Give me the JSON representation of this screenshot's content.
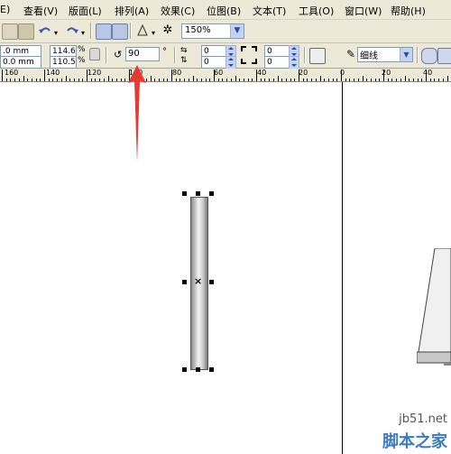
{
  "menu": [
    {
      "label": "查看(V)"
    },
    {
      "label": "版面(L)"
    },
    {
      "label": "排列(A)"
    },
    {
      "label": "效果(C)"
    },
    {
      "label": "位图(B)"
    },
    {
      "label": "文本(T)"
    },
    {
      "label": "工具(O)"
    },
    {
      "label": "窗口(W)"
    },
    {
      "label": "帮助(H)"
    }
  ],
  "toolbar": {
    "zoom_value": "150%"
  },
  "property_bar": {
    "x_value": ".0 mm",
    "y_value": "0.0 mm",
    "scale_x": "114.6",
    "scale_y": "110.5",
    "percent_symbol": "%",
    "rotation_value": "90",
    "degree_symbol": "°",
    "corner_top": "0",
    "corner_bottom": "0",
    "corner_top_right": "0",
    "corner_bottom_right": "0",
    "outline_label": "细线"
  },
  "ruler": {
    "labels": [
      "160",
      "140",
      "120",
      "100",
      "80",
      "60",
      "40",
      "20",
      "0",
      "20",
      "40"
    ]
  },
  "watermark": {
    "site": "jb51.net",
    "brand": "脚本之家"
  },
  "colors": {
    "annotation_arrow": "#e53935",
    "selection_handles": "#000000",
    "chrome": "#ece9d8"
  }
}
